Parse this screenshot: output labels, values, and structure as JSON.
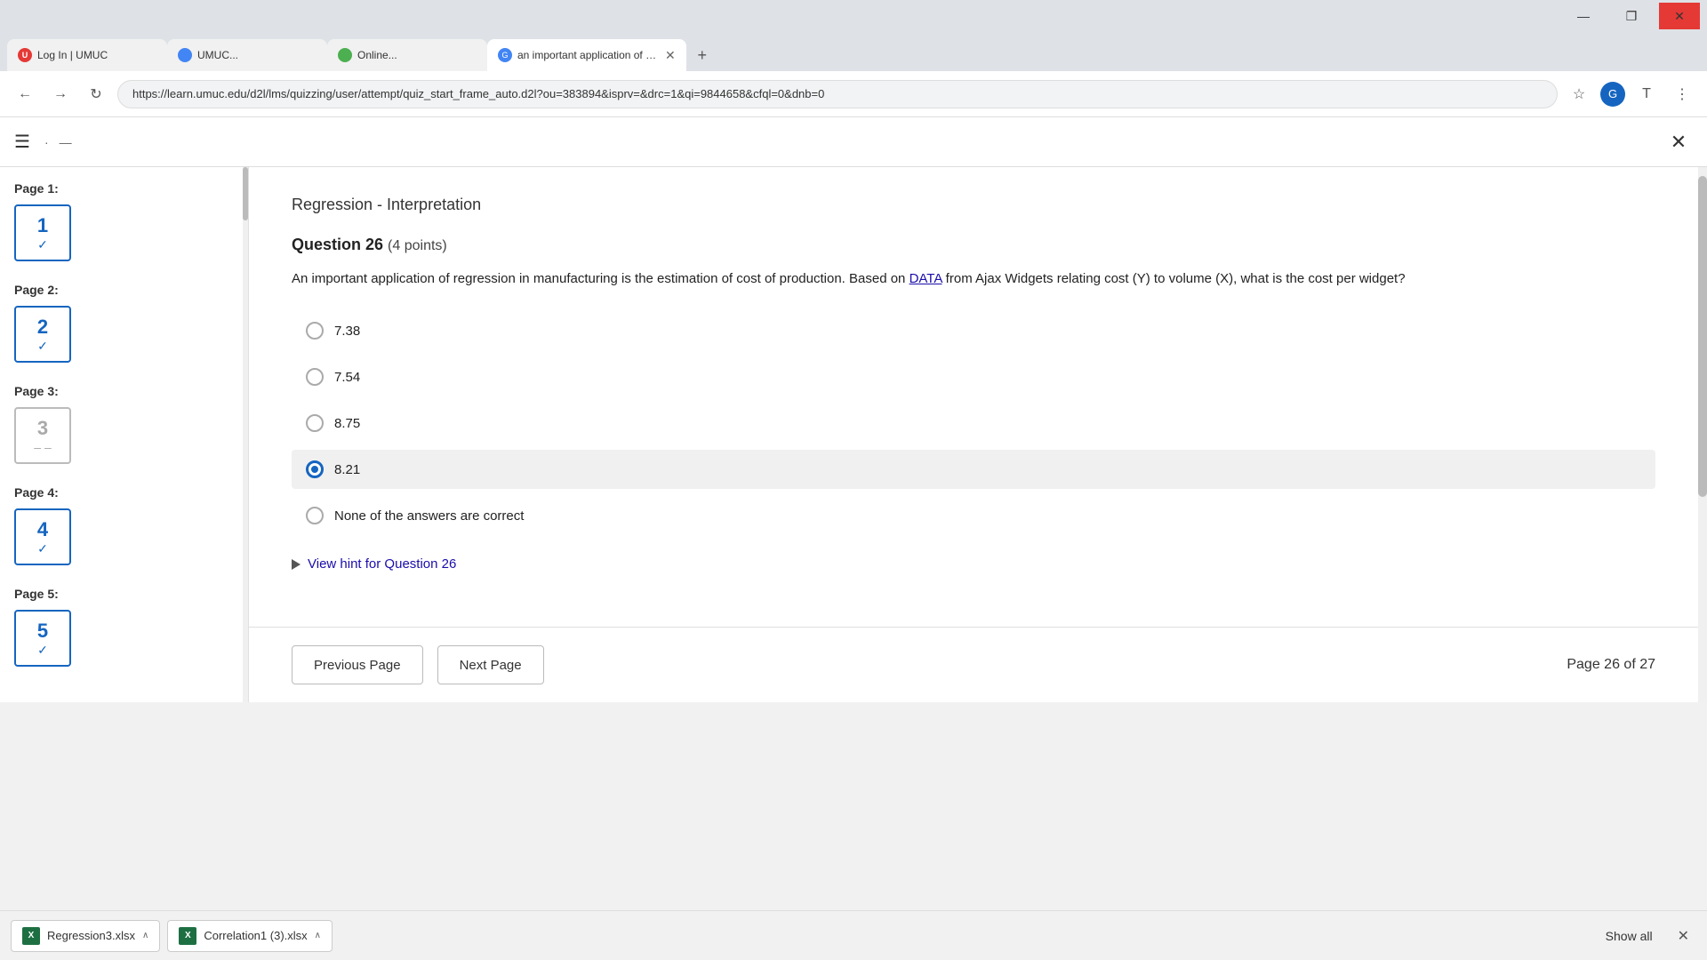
{
  "browser": {
    "tabs": [
      {
        "id": "tab1",
        "label": "Log In | UMUC",
        "favicon_color": "#e53935",
        "active": false
      },
      {
        "id": "tab2",
        "label": "UMUC...",
        "favicon_color": "#4285f4",
        "active": false
      },
      {
        "id": "tab3",
        "label": "Online...",
        "favicon_color": "#4caf50",
        "active": false
      },
      {
        "id": "tab4",
        "label": "an important application of reg...",
        "favicon_color": "#4285f4",
        "active": true
      }
    ],
    "url": "https://learn.umuc.edu/d2l/lms/quizzing/user/attempt/quiz_start_frame_auto.d2l?ou=383894&isprv=&drc=1&qi=9844658&cfql=0&dnb=0",
    "window_controls": {
      "minimize": "—",
      "maximize": "❐",
      "close": "✕"
    }
  },
  "top_nav": {
    "hamburger": "☰",
    "close_label": "✕"
  },
  "sidebar": {
    "pages": [
      {
        "id": 1,
        "label": "Page 1:",
        "number": "1",
        "status": "check",
        "status_symbol": "✓"
      },
      {
        "id": 2,
        "label": "Page 2:",
        "number": "2",
        "status": "check",
        "status_symbol": "✓"
      },
      {
        "id": 3,
        "label": "Page 3:",
        "number": "3",
        "status": "dash",
        "status_symbol": "– –"
      },
      {
        "id": 4,
        "label": "Page 4:",
        "number": "4",
        "status": "check",
        "status_symbol": "✓"
      },
      {
        "id": 5,
        "label": "Page 5:",
        "number": "5",
        "status": "check",
        "status_symbol": "✓"
      }
    ]
  },
  "quiz": {
    "section_title": "Regression - Interpretation",
    "question_number": "Question 26",
    "question_points": "(4 points)",
    "question_text_part1": "An important application of regression in manufacturing is the estimation of cost of production. Based on ",
    "question_link_text": "DATA",
    "question_text_part2": " from Ajax Widgets relating cost (Y) to volume (X), what is the cost per widget?",
    "answers": [
      {
        "id": "a1",
        "value": "7.38",
        "selected": false
      },
      {
        "id": "a2",
        "value": "7.54",
        "selected": false
      },
      {
        "id": "a3",
        "value": "8.75",
        "selected": false
      },
      {
        "id": "a4",
        "value": "8.21",
        "selected": true
      },
      {
        "id": "a5",
        "value": "None of the answers are correct",
        "selected": false
      }
    ],
    "hint_label": "View hint for Question 26",
    "nav": {
      "previous_label": "Previous Page",
      "next_label": "Next Page",
      "page_info": "Page 26 of 27"
    }
  },
  "taskbar": {
    "items": [
      {
        "id": "t1",
        "label": "Regression3.xlsx",
        "icon_text": "X"
      },
      {
        "id": "t2",
        "label": "Correlation1 (3).xlsx",
        "icon_text": "X"
      }
    ],
    "show_all_label": "Show all",
    "close_symbol": "✕",
    "chevron": "∧"
  }
}
